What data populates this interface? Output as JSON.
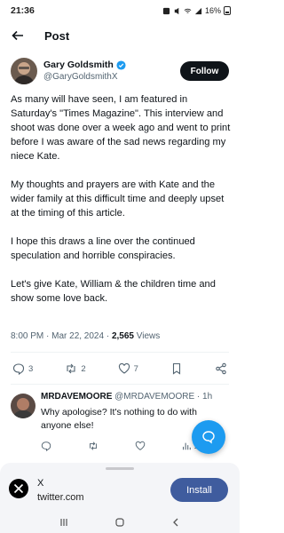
{
  "status": {
    "time": "21:36",
    "battery": "16%"
  },
  "header": {
    "title": "Post"
  },
  "author": {
    "name": "Gary Goldsmith",
    "handle": "@GaryGoldsmithX",
    "follow_label": "Follow"
  },
  "tweet": {
    "paragraphs": [
      "As many will have seen, I am featured in Saturday's \"Times Magazine\". This interview and shoot was done over a week ago and went to print before I was aware of the sad news regarding my niece Kate.",
      "My thoughts and prayers are with Kate and the wider family at this difficult time and deeply upset at the timing of this article.",
      "I hope this draws a line over the continued speculation and horrible conspiracies.",
      "Let's give Kate, William & the children time and show some love back."
    ],
    "timestamp": "8:00 PM · Mar 22, 2024 · ",
    "views_count": "2,565",
    "views_label": " Views"
  },
  "actions": {
    "replies": "3",
    "reposts": "2",
    "likes": "7"
  },
  "reply": {
    "name": "MRDAVEMOORE",
    "handle": "@MRDAVEMOORE",
    "time": " · 1h",
    "text": "Why apologise? It's nothing to do with anyone else!",
    "views": "1.",
    "more": "···"
  },
  "banner": {
    "app_name": "X",
    "domain": "twitter.com",
    "install_label": "Install"
  },
  "colors": {
    "accent": "#1d9bf0",
    "install": "#3f5c9e",
    "text": "#0f1419",
    "muted": "#536471"
  }
}
